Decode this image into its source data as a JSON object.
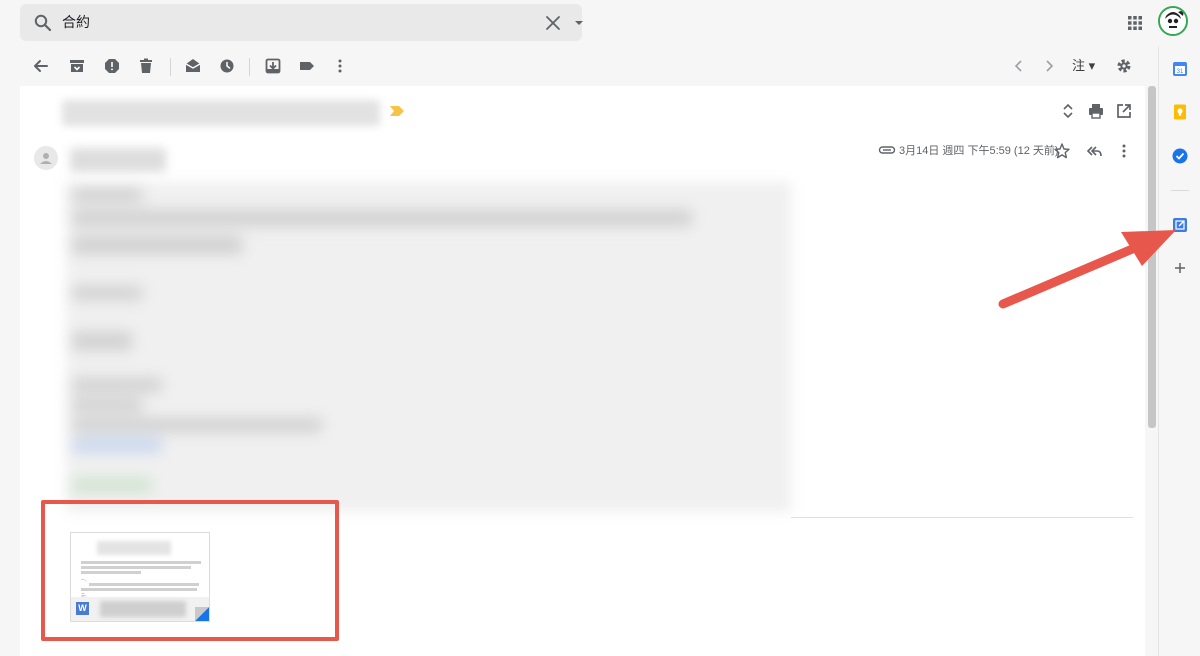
{
  "search": {
    "query": "合約",
    "icon": "search-icon",
    "clear_icon": "close-icon",
    "options_icon": "dropdown-icon"
  },
  "header": {
    "apps_icon": "apps-grid-icon",
    "avatar": "account-avatar"
  },
  "toolbar": {
    "buttons": [
      "back-icon",
      "archive-icon",
      "report-spam-icon",
      "delete-icon",
      "mark-unread-icon",
      "snooze-icon",
      "move-to-icon",
      "label-icon",
      "more-icon"
    ],
    "pager_older_icon": "chevron-left-icon",
    "pager_newer_icon": "chevron-right-icon",
    "input_tools_label": "注",
    "settings_icon": "gear-icon"
  },
  "message": {
    "date": "3月14日 週四 下午5:59 (12 天前)",
    "icons": [
      "expand-collapse-icon",
      "print-icon",
      "open-in-new-window-icon",
      "attachment-icon",
      "star-icon",
      "reply-all-icon",
      "more-icon"
    ]
  },
  "attachment": {
    "type_badge": "W",
    "preview_lines": [
      "一、",
      "二、",
      "三、"
    ]
  },
  "sidebar": {
    "icons": [
      "calendar-icon",
      "keep-icon",
      "tasks-icon",
      "add-on-icon",
      "plus-icon"
    ],
    "calendar_label": "31"
  },
  "colors": {
    "annotation": "#e8574c",
    "word": "#4a7bd0",
    "calendar": "#4285f4",
    "keep": "#fbbc04",
    "tasks": "#1a73e8"
  }
}
